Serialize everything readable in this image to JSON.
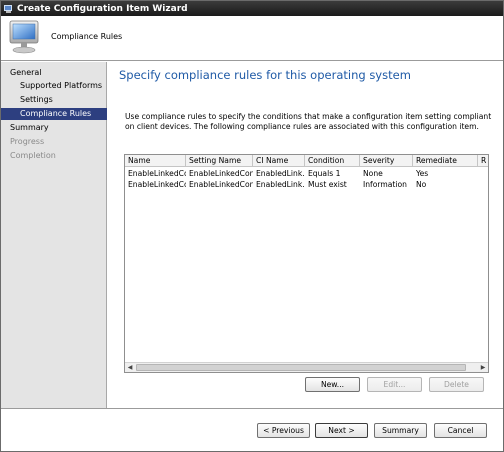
{
  "window": {
    "title": "Create Configuration Item Wizard"
  },
  "header": {
    "title": "Compliance Rules"
  },
  "nav": {
    "items": [
      {
        "label": "General",
        "indent": false,
        "state": "normal"
      },
      {
        "label": "Supported Platforms",
        "indent": true,
        "state": "normal"
      },
      {
        "label": "Settings",
        "indent": true,
        "state": "normal"
      },
      {
        "label": "Compliance Rules",
        "indent": true,
        "state": "selected"
      },
      {
        "label": "Summary",
        "indent": false,
        "state": "normal"
      },
      {
        "label": "Progress",
        "indent": false,
        "state": "disabled"
      },
      {
        "label": "Completion",
        "indent": false,
        "state": "disabled"
      }
    ]
  },
  "content": {
    "heading": "Specify compliance rules for this operating system",
    "description": "Use compliance rules to specify the conditions that make a configuration item setting compliant on client devices. The following compliance rules are associated with this configuration item."
  },
  "table": {
    "columns": [
      "Name",
      "Setting Name",
      "CI Name",
      "Condition",
      "Severity",
      "Remediate",
      "R"
    ],
    "rows": [
      [
        "EnableLinkedCo...",
        "EnableLinkedCon...",
        "EnabledLink...",
        "Equals 1",
        "None",
        "Yes"
      ],
      [
        "EnableLinkedCo...",
        "EnableLinkedCon...",
        "EnabledLink...",
        "Must exist",
        "Information",
        "No"
      ]
    ]
  },
  "buttons": {
    "new": "New...",
    "edit": "Edit...",
    "delete": "Delete",
    "previous": "< Previous",
    "next": "Next >",
    "summary": "Summary",
    "cancel": "Cancel"
  },
  "colors": {
    "accent_heading": "#1f5aa6",
    "nav_selected": "#2d3f80",
    "titlebar": "#1a1a1a"
  },
  "icons": {
    "titlebar": "computer-icon",
    "header": "computer-monitor-icon"
  }
}
